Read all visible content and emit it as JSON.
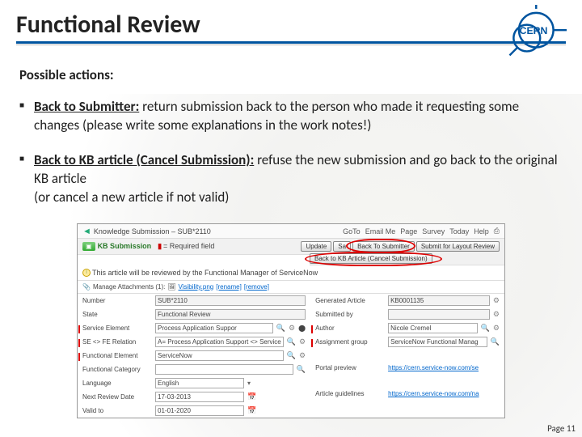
{
  "title": "Functional Review",
  "logo_text": "CERN",
  "subheading": "Possible actions:",
  "bullets": [
    {
      "label": "Back to Submitter:",
      "text": " return submission back to the person who made it requesting some changes (please write some explanations in the work notes!)"
    },
    {
      "label": "Back to KB article (Cancel Submission):",
      "text": " refuse the new submission and go back to the original KB article\n(or cancel a new article if not valid)"
    }
  ],
  "mock": {
    "breadcrumb": "Knowledge Submission – SUB*2110",
    "toolbar": {
      "goto": "GoTo",
      "emailme": "Email Me",
      "page": "Page",
      "survey": "Survey",
      "today": "Today",
      "help": "Help"
    },
    "kb_sub": "KB Submission",
    "required_note": "= Required field",
    "buttons": {
      "update": "Update",
      "save": "Sa",
      "back_to_submitter": "Back To Submitter",
      "submit_layout": "Submit for Layout Review",
      "back_to_kb": "Back to KB Article (Cancel Submission)"
    },
    "note_text": "This article will be reviewed by the Functional Manager of ServiceNow",
    "attachments": {
      "label": "Manage Attachments (1):",
      "file": "Visibility.png",
      "rename": "[rename]",
      "remove": "[remove]"
    },
    "left_fields": {
      "number": {
        "label": "Number",
        "value": "SUB*2110"
      },
      "state": {
        "label": "State",
        "value": "Functional Review"
      },
      "service_element": {
        "label": "Service Element",
        "value": "Process Application Suppor"
      },
      "se_fe_relation": {
        "label": "SE <> FE Relation",
        "value": "A= Process Application Support <> Service"
      },
      "functional_element": {
        "label": "Functional Element",
        "value": "ServiceNow"
      },
      "functional_category": {
        "label": "Functional Category",
        "value": ""
      },
      "language": {
        "label": "Language",
        "value": "English"
      },
      "next_review_date": {
        "label": "Next Review Date",
        "value": "17-03-2013"
      },
      "valid_to": {
        "label": "Valid to",
        "value": "01-01-2020"
      }
    },
    "right_fields": {
      "generated_article": {
        "label": "Generated Article",
        "value": "KB0001135"
      },
      "submitted_by": {
        "label": "Submitted by",
        "value": ""
      },
      "author": {
        "label": "Author",
        "value": "Nicole Cremel"
      },
      "assignment_group": {
        "label": "Assignment group",
        "value": "ServiceNow Functional Manag"
      },
      "portal_preview": {
        "label": "Portal preview",
        "value": "https://cern.service-now.com/se"
      },
      "article_guidelines": {
        "label": "Article guidelines",
        "value": "https://cern.service-now.com/na"
      }
    }
  },
  "page_number": "Page 11"
}
